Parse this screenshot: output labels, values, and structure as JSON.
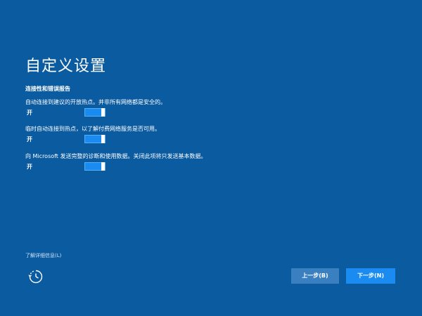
{
  "page": {
    "title": "自定义设置",
    "section_heading": "连接性和错误报告"
  },
  "settings": [
    {
      "description": "自动连接到建议的开放热点。并非所有网络都是安全的。",
      "state": "开",
      "on": true
    },
    {
      "description": "临时自动连接到热点，以了解付费网络服务是否可用。",
      "state": "开",
      "on": true
    },
    {
      "description": "向 Microsoft 发送完整的诊断和使用数据。关闭此项将只发送基本数据。",
      "state": "开",
      "on": true
    }
  ],
  "footer": {
    "learn_more": "了解详细信息(L)",
    "accessibility_icon": "ease-of-access-icon",
    "back_label": "上一步(B)",
    "next_label": "下一步(N)"
  },
  "colors": {
    "background": "#0b5ba1",
    "toggle_on": "#1a8bf0",
    "back_button": "#3a7fc0",
    "next_button": "#1a8bf0"
  }
}
